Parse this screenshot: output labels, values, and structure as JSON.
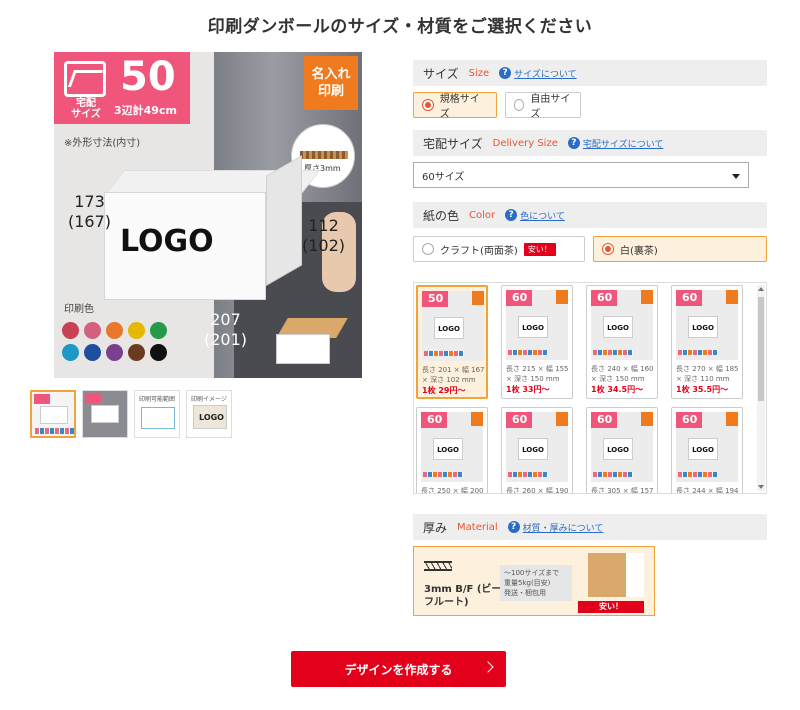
{
  "page_title": "印刷ダンボールのサイズ・材質をご選択ください",
  "hero": {
    "badge_label": "宅配\nサイズ",
    "badge_number": "50",
    "badge_sub": "3辺計49cm",
    "print_badge": "名入れ\n印刷",
    "dim_note": "※外形寸法(内寸)",
    "dim_height_outer": "173",
    "dim_height_inner": "(167)",
    "dim_depth_outer": "112",
    "dim_depth_inner": "(102)",
    "dim_width_outer": "207",
    "dim_width_inner": "(201)",
    "thickness_label": "厚さ3mm",
    "logo_text": "LOGO",
    "print_color_label": "印刷色",
    "swatch_colors": [
      "#c94154",
      "#d4607f",
      "#e8772a",
      "#e6b800",
      "#279a4a",
      "#1e98c4",
      "#1d4f9e",
      "#7a3f8e",
      "#6b3b21",
      "#111111"
    ],
    "prev_arrow": "‹",
    "next_arrow": "›"
  },
  "thumbs": [
    {
      "caption": ""
    },
    {
      "caption": ""
    },
    {
      "caption": "印刷可能範囲"
    },
    {
      "caption": "印刷イメージ",
      "logo": "LOGO"
    }
  ],
  "size_section": {
    "title": "サイズ",
    "title_en": "Size",
    "help": "サイズについて",
    "options": [
      {
        "label": "規格サイズ",
        "selected": true
      },
      {
        "label": "自由サイズ",
        "selected": false
      }
    ]
  },
  "delivery_section": {
    "title": "宅配サイズ",
    "title_en": "Delivery Size",
    "help": "宅配サイズについて",
    "selected_value": "60サイズ"
  },
  "color_section": {
    "title": "紙の色",
    "title_en": "Color",
    "help": "色について",
    "options": [
      {
        "label": "クラフト(両面茶)",
        "badge": "安い！",
        "selected": false
      },
      {
        "label": "白(裏茶)",
        "selected": true
      }
    ]
  },
  "products": [
    {
      "size": "50",
      "logo": "LOGO",
      "dims": "長さ 201 × 幅 167 × 深さ 102 mm",
      "price": "1枚 29円〜"
    },
    {
      "size": "60",
      "logo": "LOGO",
      "dims": "長さ 215 × 幅 155 × 深さ 150 mm",
      "price": "1枚 33円〜"
    },
    {
      "size": "60",
      "logo": "LOGO",
      "dims": "長さ 240 × 幅 160 × 深さ 150 mm",
      "price": "1枚 34.5円〜"
    },
    {
      "size": "60",
      "logo": "LOGO",
      "dims": "長さ 270 × 幅 185 × 深さ 110 mm",
      "price": "1枚 35.5円〜"
    },
    {
      "size": "60",
      "logo": "LOGO",
      "dims": "長さ 250 × 幅 200",
      "price": ""
    },
    {
      "size": "60",
      "logo": "LOGO",
      "dims": "長さ 260 × 幅 190",
      "price": ""
    },
    {
      "size": "60",
      "logo": "LOGO",
      "dims": "長さ 305 × 幅 157",
      "price": ""
    },
    {
      "size": "60",
      "logo": "LOGO",
      "dims": "長さ 244 × 幅 194",
      "price": ""
    }
  ],
  "material_section": {
    "title": "厚み",
    "title_en": "Material",
    "help": "材質・厚みについて",
    "card_name": "3mm B/F (ビーフルート)",
    "card_desc": "〜100サイズまで\n重量5kg(目安)\n発送・梱包用",
    "card_badge": "安い！"
  },
  "cta_label": "デザインを作成する"
}
